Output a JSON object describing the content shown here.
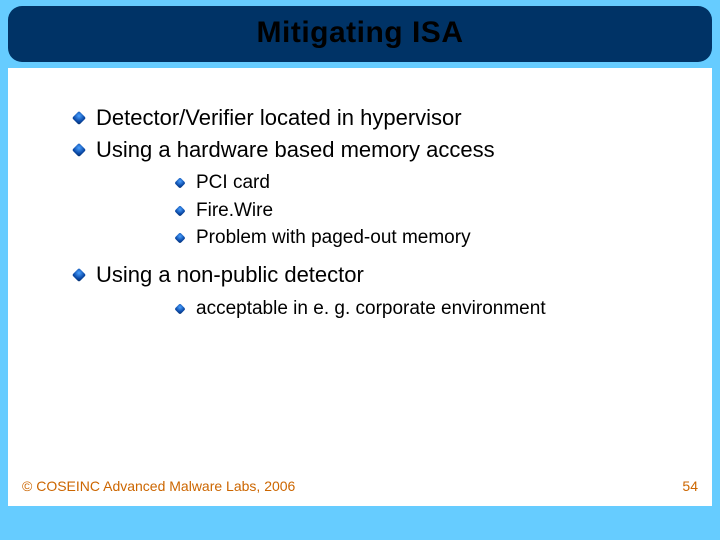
{
  "title": "Mitigating ISA",
  "bullets": {
    "b0": "Detector/Verifier located in hypervisor",
    "b1": "Using a hardware based memory access",
    "b1_0": "PCI card",
    "b1_1": "Fire.Wire",
    "b1_2": "Problem with paged-out memory",
    "b2": "Using a non-public detector",
    "b2_0": "acceptable in e. g. corporate environment"
  },
  "footer": {
    "copyright": "© COSEINC Advanced Malware Labs, 2006",
    "page": "54"
  }
}
